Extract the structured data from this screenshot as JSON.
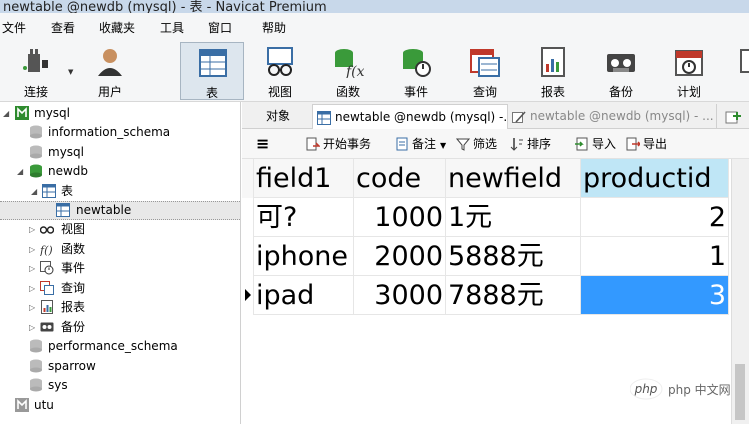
{
  "window": {
    "title": "newtable @newdb (mysql) - 表 - Navicat Premium"
  },
  "menu": [
    {
      "label": "文件"
    },
    {
      "label": "查看"
    },
    {
      "label": "收藏夹"
    },
    {
      "label": "工具"
    },
    {
      "label": "窗口"
    },
    {
      "label": "帮助"
    }
  ],
  "ribbon": [
    {
      "label": "连接",
      "icon": "plug-icon"
    },
    {
      "label": "用户",
      "icon": "user-icon"
    },
    {
      "label": "表",
      "icon": "table-icon",
      "active": true
    },
    {
      "label": "视图",
      "icon": "glasses-icon"
    },
    {
      "label": "函数",
      "icon": "function-icon"
    },
    {
      "label": "事件",
      "icon": "clock-icon"
    },
    {
      "label": "查询",
      "icon": "query-icon"
    },
    {
      "label": "报表",
      "icon": "report-icon"
    },
    {
      "label": "备份",
      "icon": "backup-icon"
    },
    {
      "label": "计划",
      "icon": "calendar-icon"
    }
  ],
  "tree": [
    {
      "label": "mysql",
      "level": 0,
      "arrow": "▲",
      "icon": "connection-icon"
    },
    {
      "label": "information_schema",
      "level": 1,
      "icon": "database-icon"
    },
    {
      "label": "mysql",
      "level": 1,
      "icon": "database-icon"
    },
    {
      "label": "newdb",
      "level": 1,
      "arrow": "▲",
      "icon": "database-icon",
      "open": true
    },
    {
      "label": "表",
      "level": 2,
      "arrow": "▲",
      "icon": "table-icon"
    },
    {
      "label": "newtable",
      "level": 3,
      "icon": "table-icon",
      "selected": true
    },
    {
      "label": "视图",
      "level": 2,
      "arrow": "▷",
      "icon": "glasses-icon"
    },
    {
      "label": "函数",
      "level": 2,
      "arrow": "▷",
      "icon": "function-icon"
    },
    {
      "label": "事件",
      "level": 2,
      "arrow": "▷",
      "icon": "clock-icon"
    },
    {
      "label": "查询",
      "level": 2,
      "arrow": "▷",
      "icon": "query-icon"
    },
    {
      "label": "报表",
      "level": 2,
      "arrow": "▷",
      "icon": "report-icon"
    },
    {
      "label": "备份",
      "level": 2,
      "arrow": "▷",
      "icon": "backup-icon"
    },
    {
      "label": "performance_schema",
      "level": 1,
      "icon": "database-icon"
    },
    {
      "label": "sparrow",
      "level": 1,
      "icon": "database-icon"
    },
    {
      "label": "sys",
      "level": 1,
      "icon": "database-icon"
    },
    {
      "label": "utu",
      "level": 0,
      "icon": "connection-icon"
    }
  ],
  "tabs": [
    {
      "label": "对象"
    },
    {
      "label": "newtable @newdb (mysql) -...",
      "active": true
    },
    {
      "label": "newtable @newdb (mysql) - ..."
    }
  ],
  "toolbar": {
    "menu_icon": "≡",
    "begin_transaction": "开始事务",
    "memo": "备注",
    "filter": "筛选",
    "sort": "排序",
    "import": "导入",
    "export": "导出"
  },
  "grid": {
    "columns": [
      "field1",
      "code",
      "newfield",
      "productid"
    ],
    "rows": [
      [
        "可?",
        "1000",
        "1元",
        "2"
      ],
      [
        "iphone",
        "2000",
        "5888元",
        "1"
      ],
      [
        "ipad",
        "3000",
        "7888元",
        "3"
      ]
    ]
  },
  "watermark": {
    "text": "php 中文网"
  },
  "colors": {
    "title_bar": "#c8d8ea",
    "selected_cell": "#3399ff",
    "selected_header": "#bfe6f6"
  }
}
